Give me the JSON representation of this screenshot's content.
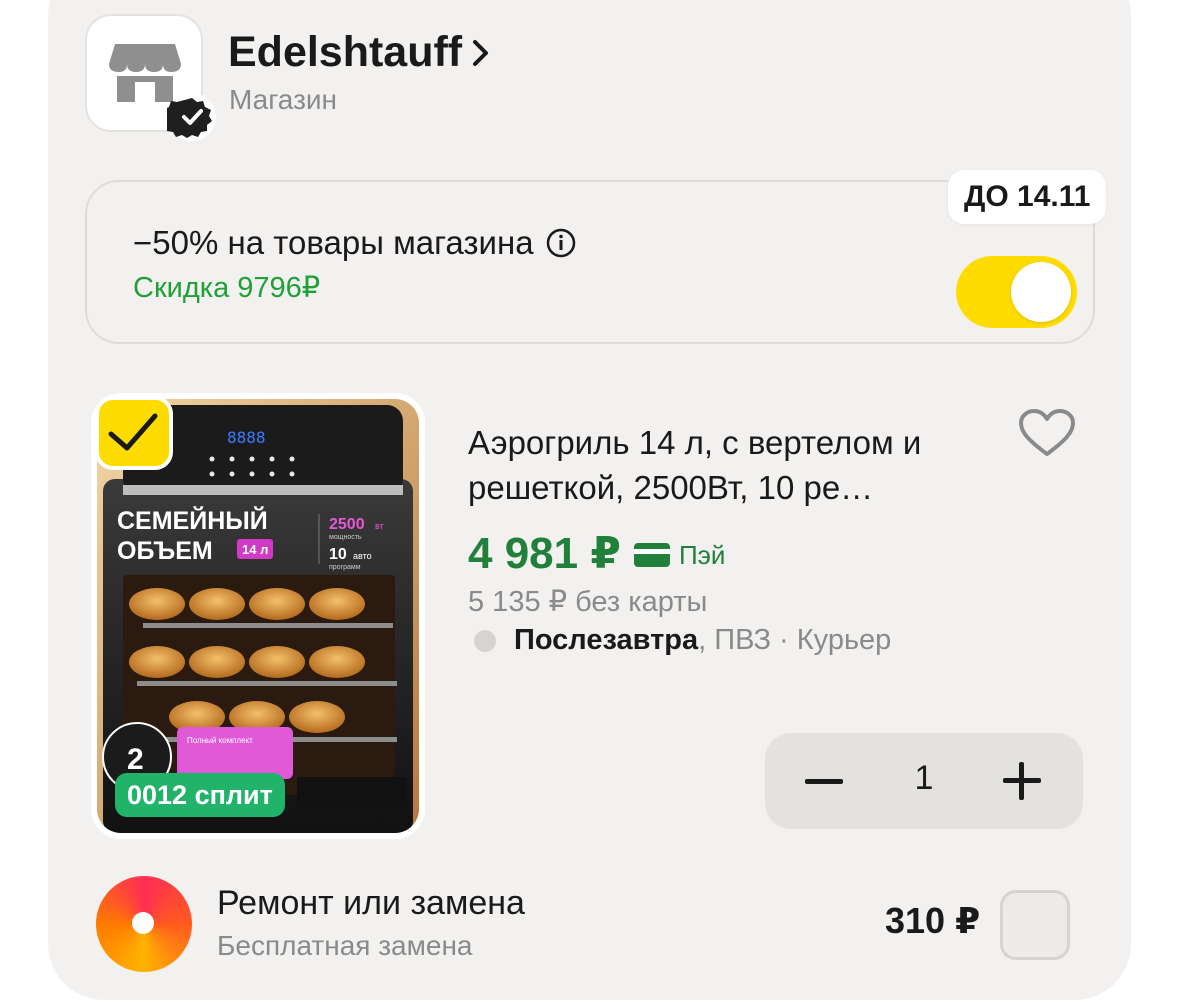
{
  "store": {
    "name": "Edelshtauff",
    "subtitle": "Магазин",
    "logo_icon": "shop-icon",
    "verified_icon": "verified-badge-icon"
  },
  "promo": {
    "title": "−50% на товары магазина",
    "discount": "Скидка 9796₽",
    "deadline": "ДО 14.11",
    "enabled": true,
    "accent": "#ffdc00"
  },
  "product": {
    "title": "Аэрогриль 14 л, с вертелом и решеткой, 2500Вт, 10 ре…",
    "price": "4 981 ₽",
    "pay_label": "Пэй",
    "old_price": "5 135 ₽  без карты",
    "delivery_date": "Послезавтра",
    "delivery_methods": ", ПВЗ · Курьер",
    "quantity": "1",
    "selected": true,
    "split_badge": "0012 сплит",
    "image_texts": {
      "line1": "СЕМЕЙНЫЙ",
      "line2": "ОБЪЕМ",
      "volume": "14 л",
      "power": "2500",
      "power_unit": "вт",
      "power_caption": "мощность",
      "programs": "10",
      "programs_unit": "авто",
      "programs_caption": "программ",
      "display": "8888",
      "warranty": "2",
      "kit": "Полный комплект"
    },
    "price_color": "#21803a"
  },
  "service": {
    "title": "Ремонт или замена",
    "subtitle": "Бесплатная замена",
    "price": "310 ₽"
  }
}
